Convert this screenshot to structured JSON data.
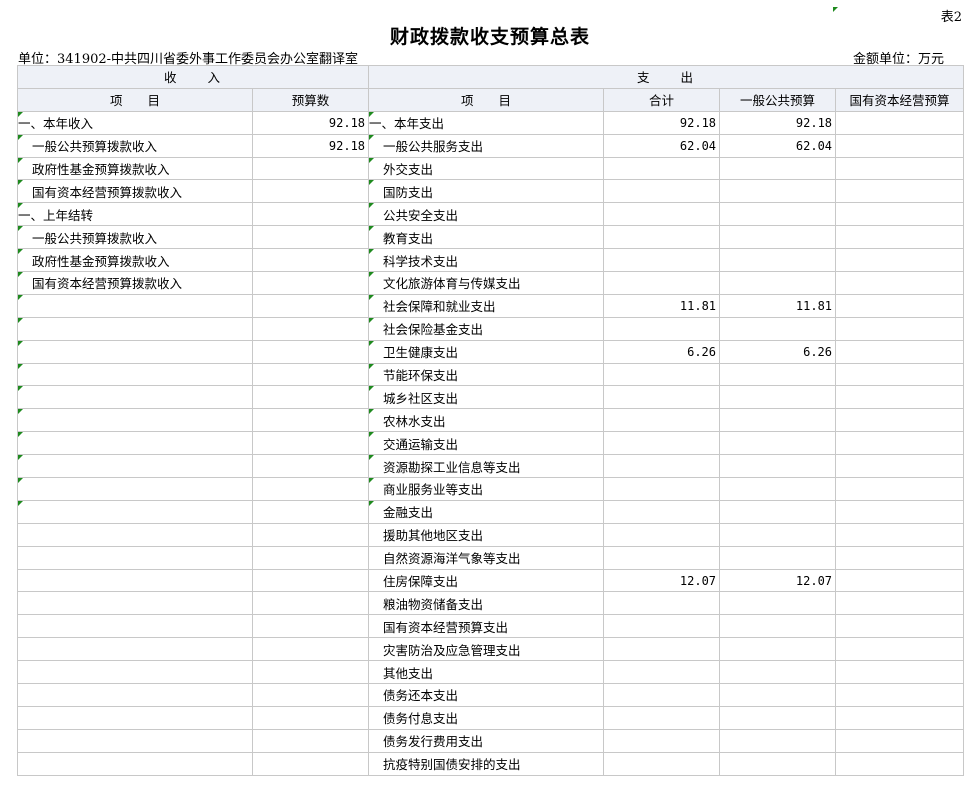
{
  "table_no": "表2",
  "title": "财政拨款收支预算总表",
  "unit_label": "单位：341902-中共四川省委外事工作委员会办公室翻译室",
  "amount_unit": "金额单位：万元",
  "headers": {
    "income_group": "收　　入",
    "expense_group": "支　　出",
    "income_item": "项　　目",
    "income_budget": "预算数",
    "expense_item": "项　　目",
    "total": "合计",
    "general_budget": "一般公共预算",
    "state_capital_budget": "国有资本经营预算"
  },
  "rows": [
    {
      "in_item": "一、本年收入",
      "in_level": 0,
      "in_value": "92.18",
      "ex_item": "一、本年支出",
      "ex_level": 0,
      "total": "92.18",
      "general": "92.18",
      "capital": ""
    },
    {
      "in_item": "一般公共预算拨款收入",
      "in_level": 1,
      "in_value": "92.18",
      "ex_item": "一般公共服务支出",
      "ex_level": 1,
      "total": "62.04",
      "general": "62.04",
      "capital": ""
    },
    {
      "in_item": "政府性基金预算拨款收入",
      "in_level": 1,
      "in_value": "",
      "ex_item": "外交支出",
      "ex_level": 1,
      "total": "",
      "general": "",
      "capital": ""
    },
    {
      "in_item": "国有资本经营预算拨款收入",
      "in_level": 1,
      "in_value": "",
      "ex_item": "国防支出",
      "ex_level": 1,
      "total": "",
      "general": "",
      "capital": ""
    },
    {
      "in_item": "一、上年结转",
      "in_level": 0,
      "in_value": "",
      "ex_item": "公共安全支出",
      "ex_level": 1,
      "total": "",
      "general": "",
      "capital": ""
    },
    {
      "in_item": "一般公共预算拨款收入",
      "in_level": 1,
      "in_value": "",
      "ex_item": "教育支出",
      "ex_level": 1,
      "total": "",
      "general": "",
      "capital": ""
    },
    {
      "in_item": "政府性基金预算拨款收入",
      "in_level": 1,
      "in_value": "",
      "ex_item": "科学技术支出",
      "ex_level": 1,
      "total": "",
      "general": "",
      "capital": ""
    },
    {
      "in_item": "国有资本经营预算拨款收入",
      "in_level": 1,
      "in_value": "",
      "ex_item": "文化旅游体育与传媒支出",
      "ex_level": 1,
      "total": "",
      "general": "",
      "capital": ""
    },
    {
      "in_item": "",
      "in_level": 1,
      "in_value": "",
      "ex_item": "社会保障和就业支出",
      "ex_level": 1,
      "total": "11.81",
      "general": "11.81",
      "capital": ""
    },
    {
      "in_item": "",
      "in_level": 1,
      "in_value": "",
      "ex_item": "社会保险基金支出",
      "ex_level": 1,
      "total": "",
      "general": "",
      "capital": ""
    },
    {
      "in_item": "",
      "in_level": 1,
      "in_value": "",
      "ex_item": "卫生健康支出",
      "ex_level": 1,
      "total": "6.26",
      "general": "6.26",
      "capital": ""
    },
    {
      "in_item": "",
      "in_level": 1,
      "in_value": "",
      "ex_item": "节能环保支出",
      "ex_level": 1,
      "total": "",
      "general": "",
      "capital": ""
    },
    {
      "in_item": "",
      "in_level": 1,
      "in_value": "",
      "ex_item": "城乡社区支出",
      "ex_level": 1,
      "total": "",
      "general": "",
      "capital": ""
    },
    {
      "in_item": "",
      "in_level": 1,
      "in_value": "",
      "ex_item": "农林水支出",
      "ex_level": 1,
      "total": "",
      "general": "",
      "capital": ""
    },
    {
      "in_item": "",
      "in_level": 1,
      "in_value": "",
      "ex_item": "交通运输支出",
      "ex_level": 1,
      "total": "",
      "general": "",
      "capital": ""
    },
    {
      "in_item": "",
      "in_level": 1,
      "in_value": "",
      "ex_item": "资源勘探工业信息等支出",
      "ex_level": 1,
      "total": "",
      "general": "",
      "capital": ""
    },
    {
      "in_item": "",
      "in_level": 1,
      "in_value": "",
      "ex_item": "商业服务业等支出",
      "ex_level": 1,
      "total": "",
      "general": "",
      "capital": ""
    },
    {
      "in_item": "",
      "in_level": 1,
      "in_value": "",
      "ex_item": "金融支出",
      "ex_level": 1,
      "total": "",
      "general": "",
      "capital": ""
    },
    {
      "in_item": "",
      "in_level": 2,
      "in_value": "",
      "ex_item": "援助其他地区支出",
      "ex_level": 2,
      "total": "",
      "general": "",
      "capital": ""
    },
    {
      "in_item": "",
      "in_level": 2,
      "in_value": "",
      "ex_item": "自然资源海洋气象等支出",
      "ex_level": 2,
      "total": "",
      "general": "",
      "capital": ""
    },
    {
      "in_item": "",
      "in_level": 2,
      "in_value": "",
      "ex_item": "住房保障支出",
      "ex_level": 2,
      "total": "12.07",
      "general": "12.07",
      "capital": ""
    },
    {
      "in_item": "",
      "in_level": 2,
      "in_value": "",
      "ex_item": "粮油物资储备支出",
      "ex_level": 2,
      "total": "",
      "general": "",
      "capital": ""
    },
    {
      "in_item": "",
      "in_level": 2,
      "in_value": "",
      "ex_item": "国有资本经营预算支出",
      "ex_level": 2,
      "total": "",
      "general": "",
      "capital": ""
    },
    {
      "in_item": "",
      "in_level": 2,
      "in_value": "",
      "ex_item": "灾害防治及应急管理支出",
      "ex_level": 2,
      "total": "",
      "general": "",
      "capital": ""
    },
    {
      "in_item": "",
      "in_level": 2,
      "in_value": "",
      "ex_item": "其他支出",
      "ex_level": 2,
      "total": "",
      "general": "",
      "capital": ""
    },
    {
      "in_item": "",
      "in_level": 2,
      "in_value": "",
      "ex_item": "债务还本支出",
      "ex_level": 2,
      "total": "",
      "general": "",
      "capital": ""
    },
    {
      "in_item": "",
      "in_level": 2,
      "in_value": "",
      "ex_item": "债务付息支出",
      "ex_level": 2,
      "total": "",
      "general": "",
      "capital": ""
    },
    {
      "in_item": "",
      "in_level": 2,
      "in_value": "",
      "ex_item": "债务发行费用支出",
      "ex_level": 2,
      "total": "",
      "general": "",
      "capital": ""
    },
    {
      "in_item": "",
      "in_level": 2,
      "in_value": "",
      "ex_item": "抗疫特别国债安排的支出",
      "ex_level": 2,
      "total": "",
      "general": "",
      "capital": ""
    }
  ]
}
